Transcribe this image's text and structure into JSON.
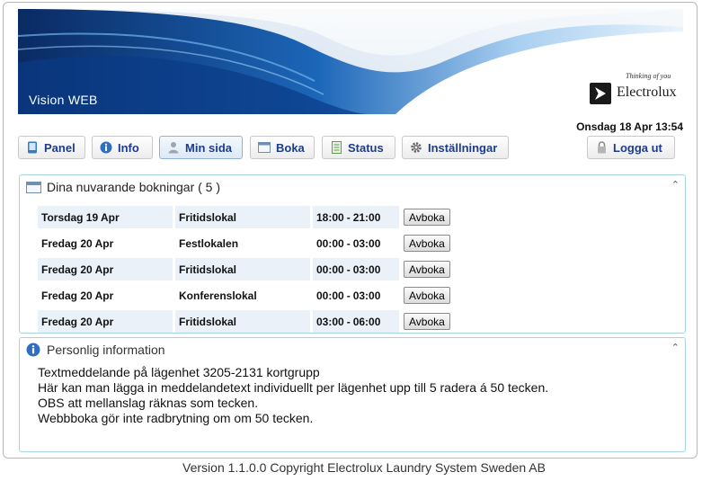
{
  "header": {
    "app_title": "Vision WEB",
    "brand_name": "Electrolux",
    "brand_slogan": "Thinking of you",
    "datetime": "Onsdag 18 Apr 13:54"
  },
  "nav": {
    "panel": "Panel",
    "info": "Info",
    "min_sida": "Min sida",
    "boka": "Boka",
    "status": "Status",
    "installningar": "Inställningar",
    "logout": "Logga ut"
  },
  "bookings": {
    "title": "Dina nuvarande bokningar ( 5 )",
    "cancel_label": "Avboka",
    "rows": [
      {
        "date": "Torsdag 19 Apr",
        "room": "Fritidslokal",
        "start": "18:00",
        "end": "21:00"
      },
      {
        "date": "Fredag 20 Apr",
        "room": "Festlokalen",
        "start": "00:00",
        "end": "03:00"
      },
      {
        "date": "Fredag 20 Apr",
        "room": "Fritidslokal",
        "start": "00:00",
        "end": "03:00"
      },
      {
        "date": "Fredag 20 Apr",
        "room": "Konferenslokal",
        "start": "00:00",
        "end": "03:00"
      },
      {
        "date": "Fredag 20 Apr",
        "room": "Fritidslokal",
        "start": "03:00",
        "end": "06:00"
      }
    ]
  },
  "personal": {
    "title": "Personlig information",
    "lines": [
      "Textmeddelande på lägenhet 3205-2131 kortgrupp",
      "Här kan man lägga in meddelandetext individuellt per lägenhet upp till 5 radera á 50 tecken.",
      "OBS att mellanslag räknas som tecken.",
      "Webbboka gör inte radbrytning om om 50 tecken."
    ]
  },
  "footer": "Version 1.1.0.0 Copyright Electrolux Laundry System Sweden AB",
  "colors": {
    "nav_text": "#1e3c8c",
    "panel_border": "#a6d3e2",
    "row_shade": "#eaf1f8"
  }
}
